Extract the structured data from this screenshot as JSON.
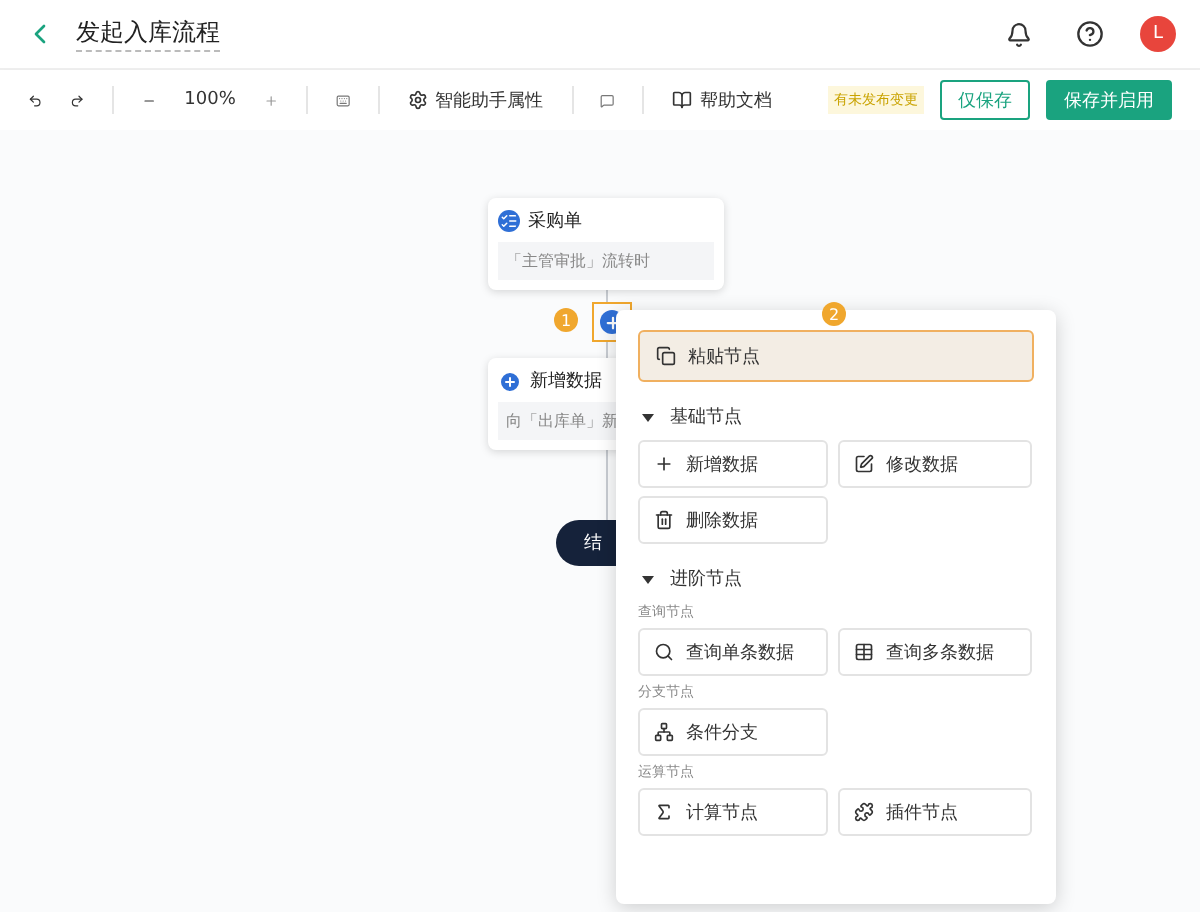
{
  "header": {
    "title": "发起入库流程",
    "avatar": "L"
  },
  "toolbar": {
    "zoom": "100%",
    "assistant": "智能助手属性",
    "help": "帮助文档",
    "status": "有未发布变更",
    "save": "仅保存",
    "save_enable": "保存并启用"
  },
  "flow": {
    "nodes": [
      {
        "kind": "node",
        "title": "采购单",
        "subtitle": "「主管审批」流转时"
      },
      {
        "kind": "node",
        "title": "新增数据",
        "subtitle": "向「出库单」新"
      },
      {
        "kind": "end",
        "title": "结"
      }
    ],
    "markers": [
      "1",
      "2"
    ]
  },
  "menu": {
    "paste": {
      "label": "粘贴节点",
      "selected": true
    },
    "sections": [
      {
        "title": "基础节点",
        "expanded": true,
        "groups": [
          {
            "items": [
              "新增数据",
              "修改数据",
              "删除数据"
            ]
          }
        ]
      },
      {
        "title": "进阶节点",
        "expanded": true,
        "groups": [
          {
            "label": "查询节点",
            "items": [
              "查询单条数据",
              "查询多条数据"
            ]
          },
          {
            "label": "分支节点",
            "items": [
              "条件分支"
            ]
          },
          {
            "label": "运算节点",
            "items": [
              "计算节点",
              "插件节点"
            ]
          }
        ]
      }
    ]
  }
}
